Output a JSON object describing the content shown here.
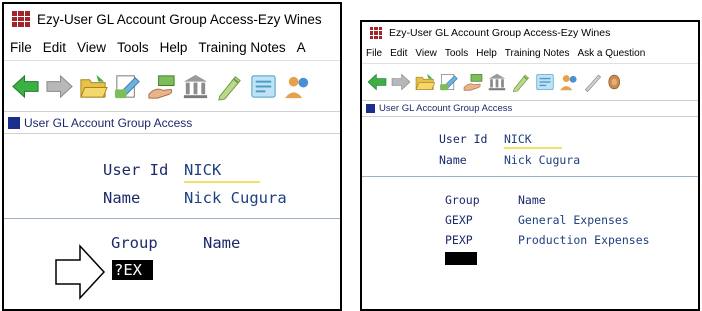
{
  "left": {
    "title": "Ezy-User GL Account Group Access-Ezy Wines",
    "menu": [
      "File",
      "Edit",
      "View",
      "Tools",
      "Help",
      "Training Notes",
      "A"
    ],
    "toolbar_icons": [
      "back-arrow-icon",
      "forward-arrow-icon",
      "open-folder-icon",
      "document-edit-icon",
      "hand-money-icon",
      "bank-icon",
      "pencil-document-icon",
      "notes-icon",
      "users-icon"
    ],
    "ribbon_label": "User GL Account Group Access",
    "user_id_label": "User Id",
    "user_id_value": "NICK",
    "name_label": "Name",
    "name_value": "Nick Cugura",
    "group_header": "Group",
    "name_header": "Name",
    "group_input": "?EX"
  },
  "right": {
    "title": "Ezy-User GL Account Group Access-Ezy Wines",
    "menu": [
      "File",
      "Edit",
      "View",
      "Tools",
      "Help",
      "Training Notes",
      "Ask a Question"
    ],
    "toolbar_icons": [
      "back-arrow-icon",
      "forward-arrow-icon",
      "open-folder-icon",
      "document-edit-icon",
      "hand-money-icon",
      "bank-icon",
      "pencil-document-icon",
      "notes-icon",
      "users-icon",
      "pen-icon",
      "wood-log-icon"
    ],
    "ribbon_label": "User GL Account Group Access",
    "user_id_label": "User Id",
    "user_id_value": "NICK",
    "name_label": "Name",
    "name_value": "Nick Cugura",
    "group_header": "Group",
    "name_header": "Name",
    "rows": [
      {
        "group": "GEXP",
        "name": "General Expenses"
      },
      {
        "group": "PEXP",
        "name": "Production Expenses"
      }
    ]
  },
  "colors": {
    "label": "#1c2a6b",
    "value": "#204080",
    "underline": "#f1e26a",
    "ribbon_square": "#1a2f8c",
    "app_icon": "#a0262b"
  }
}
